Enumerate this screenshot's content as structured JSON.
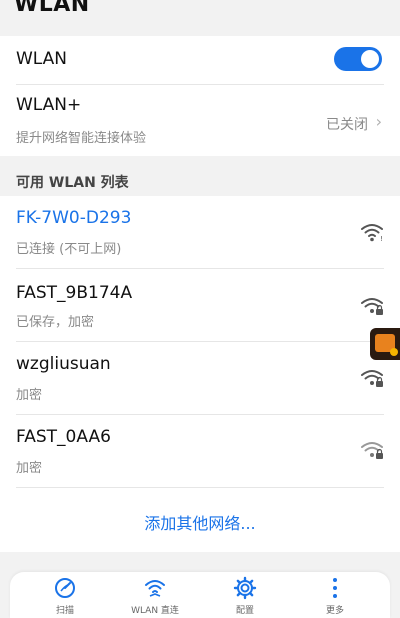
{
  "header": {
    "title": "WLAN"
  },
  "wlan_toggle": {
    "label": "WLAN",
    "on": true
  },
  "wlan_plus": {
    "title": "WLAN+",
    "subtitle": "提升网络智能连接体验",
    "status": "已关闭"
  },
  "section": {
    "label": "可用 WLAN 列表"
  },
  "networks": [
    {
      "ssid": "FK-7W0-D293",
      "status": "已连接 (不可上网)",
      "connected": true,
      "locked": false
    },
    {
      "ssid": "FAST_9B174A",
      "status": "已保存，加密",
      "connected": false,
      "locked": true
    },
    {
      "ssid": "wzgliusuan",
      "status": "加密",
      "connected": false,
      "locked": true
    },
    {
      "ssid": "FAST_0AA6",
      "status": "加密",
      "connected": false,
      "locked": true
    }
  ],
  "add_network": {
    "label": "添加其他网络..."
  },
  "bottom_nav": [
    {
      "label": "扫描",
      "icon": "scan-icon"
    },
    {
      "label": "WLAN 直连",
      "icon": "wifi-direct-icon"
    },
    {
      "label": "配置",
      "icon": "settings-gear-icon"
    },
    {
      "label": "更多",
      "icon": "more-vertical-icon"
    }
  ],
  "colors": {
    "accent": "#1a73e8",
    "background": "#f2f2f2",
    "card": "#ffffff",
    "subtext": "#8a8a8a"
  }
}
